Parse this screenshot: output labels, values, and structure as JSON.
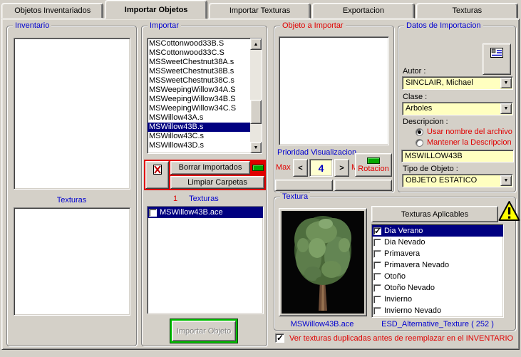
{
  "tabs": [
    {
      "label": "Objetos Inventariados",
      "active": false
    },
    {
      "label": "Importar Objetos",
      "active": true
    },
    {
      "label": "Importar Texturas",
      "active": false
    },
    {
      "label": "Exportacion",
      "active": false
    },
    {
      "label": "Texturas",
      "active": false
    }
  ],
  "icons": {
    "scroll_up": "▲",
    "scroll_down": "▼",
    "combo_arrow": "▼",
    "spin_prev": "<",
    "spin_next": ">"
  },
  "inventario": {
    "title": "Inventario",
    "texturas_label": "Texturas"
  },
  "importar": {
    "title": "Importar",
    "files": [
      "MSCottonwood33B.S",
      "MSCottonwood33C.S",
      "MSSweetChestnut38A.s",
      "MSSweetChestnut38B.s",
      "MSSweetChestnut38C.s",
      "MSWeepingWillow34A.S",
      "MSWeepingWillow34B.S",
      "MSWeepingWillow34C.S",
      "MSWillow43A.s",
      "MSWillow43B.s",
      "MSWillow43C.s",
      "MSWillow43D.s"
    ],
    "selected_index": 9,
    "borrar_button": "Borrar Importados",
    "limpiar_button": "Limpiar Carpetas",
    "texturas_count": "1",
    "texturas_label": "Texturas",
    "texture_items": [
      {
        "label": "MSWillow43B.ace",
        "checked": false,
        "selected": true
      }
    ],
    "importar_objeto_button": "Importar Objeto"
  },
  "objeto": {
    "title": "Objeto a Importar",
    "prioridad_label": "Prioridad Visualizacion",
    "max_label": "Max",
    "min_label": "Min",
    "prioridad_value": "4",
    "rotacion_button": "Rotacion"
  },
  "datos": {
    "title": "Datos de Importacion",
    "autor_label": "Autor :",
    "autor_value": "SINCLAIR, Michael",
    "clase_label": "Clase :",
    "clase_value": "Arboles",
    "descripcion_label": "Descripcion :",
    "radio_usar": "Usar nombre del archivo",
    "radio_mantener": "Mantener la Descripcion",
    "descripcion_mode": "usar",
    "descripcion_value": "MSWILLOW43B",
    "tipo_label": "Tipo de Objeto :",
    "tipo_value": "OBJETO ESTATICO"
  },
  "textura": {
    "title": "Textura",
    "aplicables_button": "Texturas Aplicables",
    "items": [
      {
        "label": "Dia Verano",
        "checked": true,
        "selected": true
      },
      {
        "label": "Dia Nevado",
        "checked": false,
        "selected": false
      },
      {
        "label": "Primavera",
        "checked": false,
        "selected": false
      },
      {
        "label": "Primavera Nevado",
        "checked": false,
        "selected": false
      },
      {
        "label": "Otoño",
        "checked": false,
        "selected": false
      },
      {
        "label": "Otoño Nevado",
        "checked": false,
        "selected": false
      },
      {
        "label": "Invierno",
        "checked": false,
        "selected": false
      },
      {
        "label": "Invierno Nevado",
        "checked": false,
        "selected": false
      }
    ],
    "image_label": "MSWillow43B.ace",
    "esd_label": "ESD_Alternative_Texture ( 252 )"
  },
  "footer": {
    "checkbox_label": "Ver texturas duplicadas antes de reemplazar en el INVENTARIO",
    "checked": true
  },
  "colors": {
    "window_bg": "#d4d0c8",
    "selection": "#000080",
    "field_yellow": "#ffffc0",
    "label_blue": "#0000d0",
    "label_red": "#e00000",
    "accent_green": "#00c000",
    "warning_yellow": "#ffff00"
  }
}
